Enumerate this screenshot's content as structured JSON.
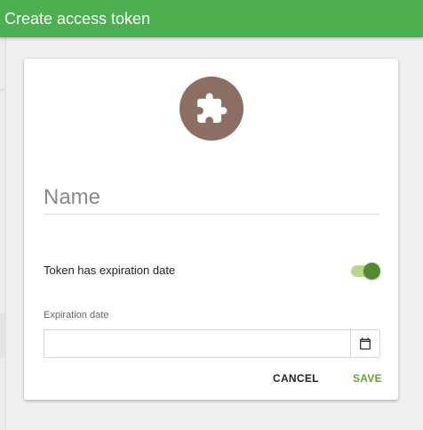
{
  "header": {
    "title": "Create access token"
  },
  "form": {
    "avatar_icon": "puzzle-piece-icon",
    "name_placeholder": "Name",
    "name_value": "",
    "expiration_toggle_label": "Token has expiration date",
    "expiration_toggle_on": true,
    "expiration_date_label": "Expiration date",
    "expiration_date_value": "",
    "calendar_icon": "calendar-icon"
  },
  "actions": {
    "cancel_label": "CANCEL",
    "save_label": "SAVE"
  },
  "colors": {
    "header": "#4caf50",
    "avatar": "#8d6e63",
    "toggle_thumb": "#558b2f",
    "toggle_track": "#9ccc65",
    "save_text": "#689f38"
  }
}
